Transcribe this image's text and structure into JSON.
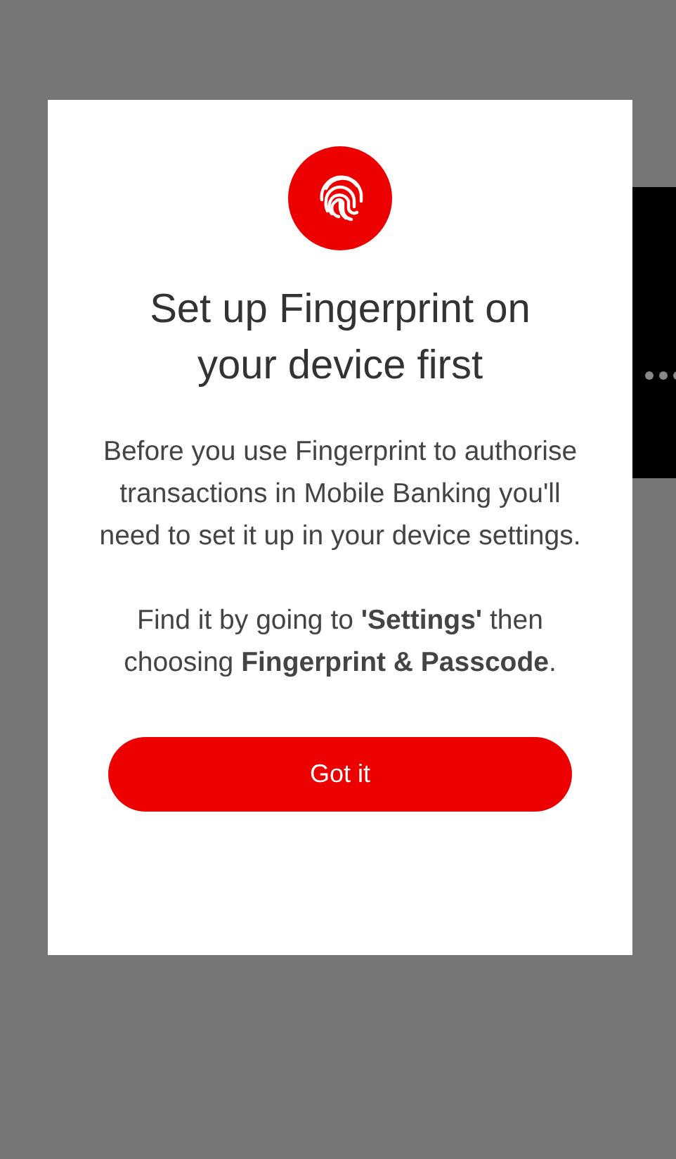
{
  "dialog": {
    "title": "Set up Fingerprint on your device first",
    "paragraphs": [
      "Before you use Fingerprint to authorise transactions in Mobile Banking you'll need to set it up in your device settings.",
      "Find it by going to **'Settings'** then choosing **Fingerprint & Passcode**."
    ],
    "button": "Got it"
  }
}
